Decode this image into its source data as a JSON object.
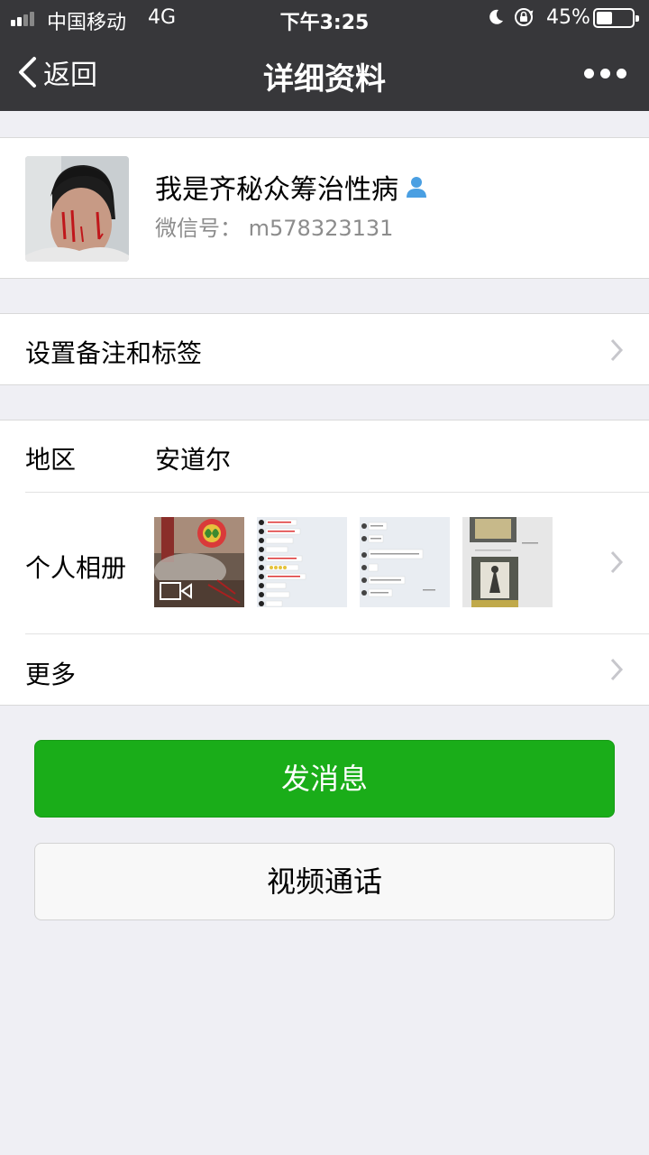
{
  "status_bar": {
    "carrier": "中国移动",
    "network": "4G",
    "time": "下午3:25",
    "battery_percent": "45%",
    "battery_level": 0.45,
    "icons": [
      "signal-icon",
      "moon-icon",
      "rotation-lock-icon",
      "battery-icon"
    ]
  },
  "nav": {
    "back_label": "返回",
    "title": "详细资料",
    "more_icon": "more-dots-icon"
  },
  "profile": {
    "name": "我是齐秘众筹治性病",
    "wechat_id": "微信号：  m578323131",
    "friend_icon": "person-icon"
  },
  "remark": {
    "label": "设置备注和标签"
  },
  "info": {
    "region_label": "地区",
    "region_value": "安道尔",
    "album_label": "个人相册",
    "album_thumbnails": [
      "video-thumbnail",
      "chat-screenshot",
      "chat-screenshot",
      "photo-thumbnail"
    ],
    "more_label": "更多"
  },
  "actions": {
    "message_label": "发消息",
    "video_call_label": "视频通话"
  },
  "colors": {
    "nav_background": "#37373a",
    "page_background": "#efeff4",
    "primary_button": "#1aad19",
    "friend_icon": "#4a9fe2"
  }
}
